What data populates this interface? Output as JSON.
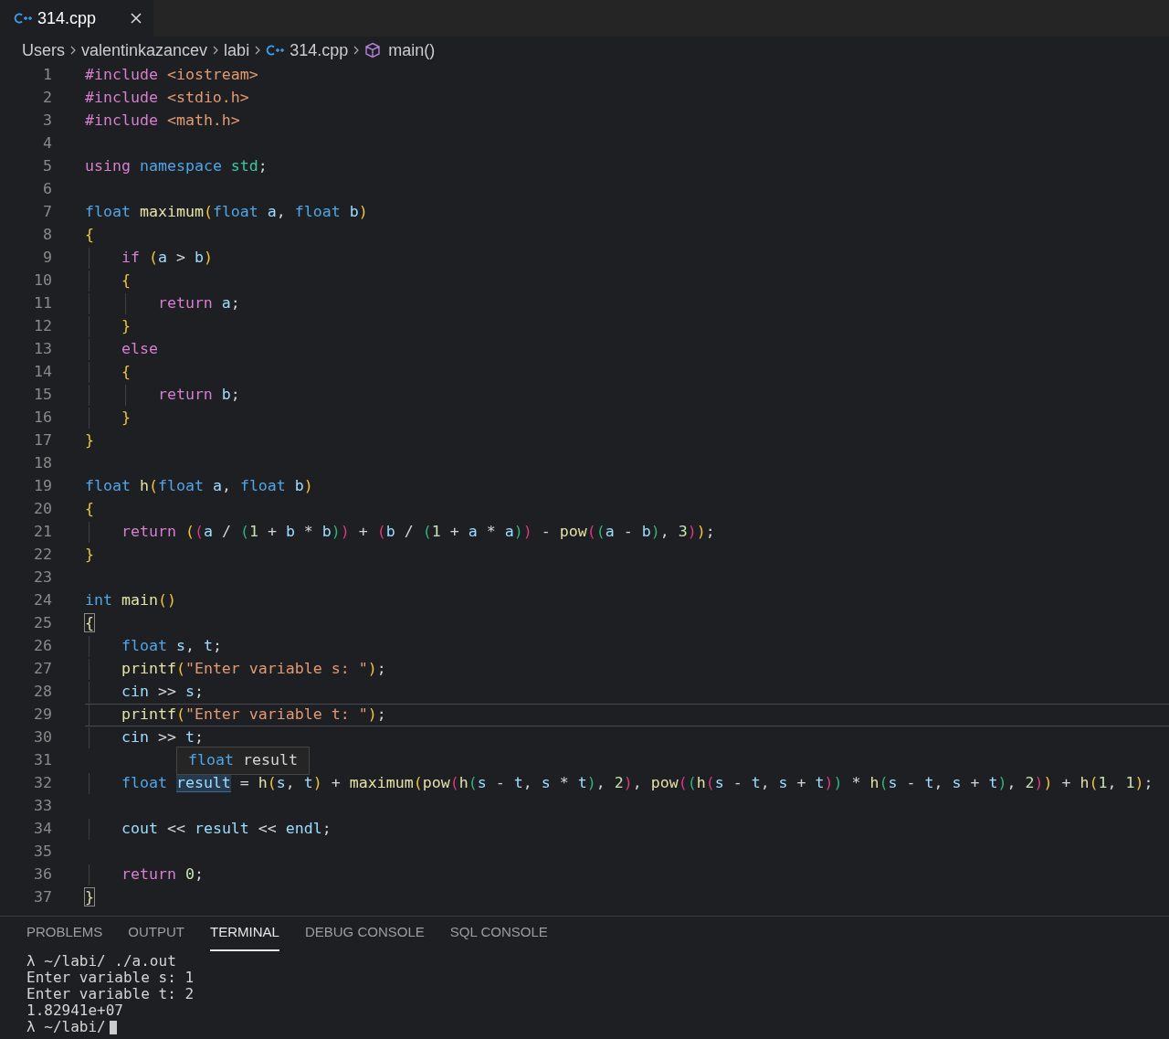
{
  "tabs": [
    {
      "label": "314.cpp",
      "selected": true
    }
  ],
  "breadcrumb": [
    {
      "label": "Users",
      "kind": "folder"
    },
    {
      "label": "valentinkazancev",
      "kind": "folder"
    },
    {
      "label": "labi",
      "kind": "folder"
    },
    {
      "label": "314.cpp",
      "kind": "file"
    },
    {
      "label": "main()",
      "kind": "symbol"
    }
  ],
  "lines": [
    {
      "number": "1",
      "current": false,
      "tokens": [
        {
          "kind": "keyword",
          "text": "#include "
        },
        {
          "kind": "string",
          "text": "<iostream>"
        }
      ]
    },
    {
      "number": "2",
      "current": false,
      "tokens": [
        {
          "kind": "keyword",
          "text": "#include "
        },
        {
          "kind": "string",
          "text": "<stdio.h>"
        }
      ]
    },
    {
      "number": "3",
      "current": false,
      "tokens": [
        {
          "kind": "keyword",
          "text": "#include "
        },
        {
          "kind": "string",
          "text": "<math.h>"
        }
      ]
    },
    {
      "number": "4",
      "current": false
    },
    {
      "number": "5",
      "current": false,
      "tokens": [
        {
          "kind": "keyword",
          "text": "using "
        },
        {
          "kind": "type",
          "text": "namespace "
        },
        {
          "kind": "class",
          "text": "std"
        },
        {
          "kind": "plain",
          "text": ";"
        }
      ]
    },
    {
      "number": "6",
      "current": false
    },
    {
      "number": "7",
      "current": false,
      "tokens": [
        {
          "kind": "type",
          "text": "float "
        },
        {
          "kind": "function",
          "text": "maximum"
        },
        {
          "kind": "bracket1",
          "text": "("
        },
        {
          "kind": "type",
          "text": "float "
        },
        {
          "kind": "variable",
          "text": "a"
        },
        {
          "kind": "plain",
          "text": ", "
        },
        {
          "kind": "type",
          "text": "float "
        },
        {
          "kind": "variable",
          "text": "b"
        },
        {
          "kind": "bracket1",
          "text": ")"
        }
      ]
    },
    {
      "number": "8",
      "current": false,
      "tokens": [
        {
          "kind": "bracket1",
          "text": "{"
        }
      ]
    },
    {
      "number": "9",
      "current": false,
      "tokens": [
        {
          "kind": "keyword",
          "text": "    if "
        },
        {
          "kind": "bracket1",
          "text": "("
        },
        {
          "kind": "variable",
          "text": "a"
        },
        {
          "kind": "plain",
          "text": " > "
        },
        {
          "kind": "variable",
          "text": "b"
        },
        {
          "kind": "bracket1",
          "text": ")"
        }
      ]
    },
    {
      "number": "10",
      "current": false,
      "tokens": [
        {
          "kind": "bracket1",
          "text": "    {"
        }
      ]
    },
    {
      "number": "11",
      "current": false,
      "tokens": [
        {
          "kind": "keyword",
          "text": "        return "
        },
        {
          "kind": "variable",
          "text": "a"
        },
        {
          "kind": "plain",
          "text": ";"
        }
      ]
    },
    {
      "number": "12",
      "current": false,
      "tokens": [
        {
          "kind": "bracket1",
          "text": "    }"
        }
      ]
    },
    {
      "number": "13",
      "current": false,
      "tokens": [
        {
          "kind": "keyword",
          "text": "    else"
        }
      ]
    },
    {
      "number": "14",
      "current": false,
      "tokens": [
        {
          "kind": "bracket1",
          "text": "    {"
        }
      ]
    },
    {
      "number": "15",
      "current": false,
      "tokens": [
        {
          "kind": "keyword",
          "text": "        return "
        },
        {
          "kind": "variable",
          "text": "b"
        },
        {
          "kind": "plain",
          "text": ";"
        }
      ]
    },
    {
      "number": "16",
      "current": false,
      "tokens": [
        {
          "kind": "bracket1",
          "text": "    }"
        }
      ]
    },
    {
      "number": "17",
      "current": false,
      "tokens": [
        {
          "kind": "bracket1",
          "text": "}"
        }
      ]
    },
    {
      "number": "18",
      "current": false
    },
    {
      "number": "19",
      "current": false,
      "tokens": [
        {
          "kind": "type",
          "text": "float "
        },
        {
          "kind": "function",
          "text": "h"
        },
        {
          "kind": "bracket1",
          "text": "("
        },
        {
          "kind": "type",
          "text": "float "
        },
        {
          "kind": "variable",
          "text": "a"
        },
        {
          "kind": "plain",
          "text": ", "
        },
        {
          "kind": "type",
          "text": "float "
        },
        {
          "kind": "variable",
          "text": "b"
        },
        {
          "kind": "bracket1",
          "text": ")"
        }
      ]
    },
    {
      "number": "20",
      "current": false,
      "tokens": [
        {
          "kind": "bracket1",
          "text": "{"
        }
      ]
    },
    {
      "number": "21",
      "current": false,
      "tokens": [
        {
          "kind": "keyword",
          "text": "    return "
        },
        {
          "kind": "bracket1",
          "text": "("
        },
        {
          "kind": "bracket2",
          "text": "("
        },
        {
          "kind": "variable",
          "text": "a"
        },
        {
          "kind": "plain",
          "text": " / "
        },
        {
          "kind": "bracket3",
          "text": "("
        },
        {
          "kind": "number",
          "text": "1"
        },
        {
          "kind": "plain",
          "text": " + "
        },
        {
          "kind": "variable",
          "text": "b"
        },
        {
          "kind": "plain",
          "text": " * "
        },
        {
          "kind": "variable",
          "text": "b"
        },
        {
          "kind": "bracket3",
          "text": ")"
        },
        {
          "kind": "bracket2",
          "text": ")"
        },
        {
          "kind": "plain",
          "text": " + "
        },
        {
          "kind": "bracket2",
          "text": "("
        },
        {
          "kind": "variable",
          "text": "b"
        },
        {
          "kind": "plain",
          "text": " / "
        },
        {
          "kind": "bracket3",
          "text": "("
        },
        {
          "kind": "number",
          "text": "1"
        },
        {
          "kind": "plain",
          "text": " + "
        },
        {
          "kind": "variable",
          "text": "a"
        },
        {
          "kind": "plain",
          "text": " * "
        },
        {
          "kind": "variable",
          "text": "a"
        },
        {
          "kind": "bracket3",
          "text": ")"
        },
        {
          "kind": "bracket2",
          "text": ")"
        },
        {
          "kind": "plain",
          "text": " - "
        },
        {
          "kind": "function",
          "text": "pow"
        },
        {
          "kind": "bracket2",
          "text": "("
        },
        {
          "kind": "bracket3",
          "text": "("
        },
        {
          "kind": "variable",
          "text": "a"
        },
        {
          "kind": "plain",
          "text": " - "
        },
        {
          "kind": "variable",
          "text": "b"
        },
        {
          "kind": "bracket3",
          "text": ")"
        },
        {
          "kind": "plain",
          "text": ", "
        },
        {
          "kind": "number",
          "text": "3"
        },
        {
          "kind": "bracket2",
          "text": ")"
        },
        {
          "kind": "bracket1",
          "text": ")"
        },
        {
          "kind": "plain",
          "text": ";"
        }
      ]
    },
    {
      "number": "22",
      "current": false,
      "tokens": [
        {
          "kind": "bracket1",
          "text": "}"
        }
      ]
    },
    {
      "number": "23",
      "current": false
    },
    {
      "number": "24",
      "current": false,
      "tokens": [
        {
          "kind": "type",
          "text": "int "
        },
        {
          "kind": "function",
          "text": "main"
        },
        {
          "kind": "bracket1",
          "text": "()"
        }
      ]
    },
    {
      "number": "25",
      "current": false,
      "tokens": [
        {
          "kind": "match",
          "text": "{"
        }
      ]
    },
    {
      "number": "26",
      "current": false,
      "tokens": [
        {
          "kind": "type",
          "text": "    float "
        },
        {
          "kind": "variable",
          "text": "s"
        },
        {
          "kind": "plain",
          "text": ", "
        },
        {
          "kind": "variable",
          "text": "t"
        },
        {
          "kind": "plain",
          "text": ";"
        }
      ]
    },
    {
      "number": "27",
      "current": false,
      "tokens": [
        {
          "kind": "function",
          "text": "    printf"
        },
        {
          "kind": "bracket1",
          "text": "("
        },
        {
          "kind": "string",
          "text": "\"Enter variable s: \""
        },
        {
          "kind": "bracket1",
          "text": ")"
        },
        {
          "kind": "plain",
          "text": ";"
        }
      ]
    },
    {
      "number": "28",
      "current": false,
      "tokens": [
        {
          "kind": "variable",
          "text": "    cin"
        },
        {
          "kind": "plain",
          "text": " >> "
        },
        {
          "kind": "variable",
          "text": "s"
        },
        {
          "kind": "plain",
          "text": ";"
        }
      ]
    },
    {
      "number": "29",
      "current": true,
      "tokens": [
        {
          "kind": "function",
          "text": "    printf"
        },
        {
          "kind": "bracket1",
          "text": "("
        },
        {
          "kind": "string",
          "text": "\"Enter variable t: \""
        },
        {
          "kind": "bracket1",
          "text": ")"
        },
        {
          "kind": "plain",
          "text": ";"
        }
      ]
    },
    {
      "number": "30",
      "current": false,
      "tokens": [
        {
          "kind": "variable",
          "text": "    cin"
        },
        {
          "kind": "plain",
          "text": " >> "
        },
        {
          "kind": "variable",
          "text": "t"
        },
        {
          "kind": "plain",
          "text": ";"
        }
      ]
    },
    {
      "number": "31",
      "current": false
    },
    {
      "number": "32",
      "current": false,
      "tokens": [
        {
          "kind": "type",
          "text": "    float "
        },
        {
          "kind": "highlight",
          "text": "result"
        },
        {
          "kind": "plain",
          "text": " = "
        },
        {
          "kind": "function",
          "text": "h"
        },
        {
          "kind": "bracket1",
          "text": "("
        },
        {
          "kind": "variable",
          "text": "s"
        },
        {
          "kind": "plain",
          "text": ", "
        },
        {
          "kind": "variable",
          "text": "t"
        },
        {
          "kind": "bracket1",
          "text": ")"
        },
        {
          "kind": "plain",
          "text": " + "
        },
        {
          "kind": "function",
          "text": "maximum"
        },
        {
          "kind": "bracket1",
          "text": "("
        },
        {
          "kind": "function",
          "text": "pow"
        },
        {
          "kind": "bracket2",
          "text": "("
        },
        {
          "kind": "function",
          "text": "h"
        },
        {
          "kind": "bracket3",
          "text": "("
        },
        {
          "kind": "variable",
          "text": "s"
        },
        {
          "kind": "plain",
          "text": " - "
        },
        {
          "kind": "variable",
          "text": "t"
        },
        {
          "kind": "plain",
          "text": ", "
        },
        {
          "kind": "variable",
          "text": "s"
        },
        {
          "kind": "plain",
          "text": " * "
        },
        {
          "kind": "variable",
          "text": "t"
        },
        {
          "kind": "bracket3",
          "text": ")"
        },
        {
          "kind": "plain",
          "text": ", "
        },
        {
          "kind": "number",
          "text": "2"
        },
        {
          "kind": "bracket2",
          "text": ")"
        },
        {
          "kind": "plain",
          "text": ", "
        },
        {
          "kind": "function",
          "text": "pow"
        },
        {
          "kind": "bracket2",
          "text": "("
        },
        {
          "kind": "bracket3",
          "text": "("
        },
        {
          "kind": "function",
          "text": "h"
        },
        {
          "kind": "bracket2",
          "text": "("
        },
        {
          "kind": "variable",
          "text": "s"
        },
        {
          "kind": "plain",
          "text": " - "
        },
        {
          "kind": "variable",
          "text": "t"
        },
        {
          "kind": "plain",
          "text": ", "
        },
        {
          "kind": "variable",
          "text": "s"
        },
        {
          "kind": "plain",
          "text": " + "
        },
        {
          "kind": "variable",
          "text": "t"
        },
        {
          "kind": "bracket2",
          "text": ")"
        },
        {
          "kind": "bracket3",
          "text": ")"
        },
        {
          "kind": "plain",
          "text": " * "
        },
        {
          "kind": "function",
          "text": "h"
        },
        {
          "kind": "bracket3",
          "text": "("
        },
        {
          "kind": "variable",
          "text": "s"
        },
        {
          "kind": "plain",
          "text": " - "
        },
        {
          "kind": "variable",
          "text": "t"
        },
        {
          "kind": "plain",
          "text": ", "
        },
        {
          "kind": "variable",
          "text": "s"
        },
        {
          "kind": "plain",
          "text": " + "
        },
        {
          "kind": "variable",
          "text": "t"
        },
        {
          "kind": "bracket3",
          "text": ")"
        },
        {
          "kind": "plain",
          "text": ", "
        },
        {
          "kind": "number",
          "text": "2"
        },
        {
          "kind": "bracket2",
          "text": ")"
        },
        {
          "kind": "bracket1",
          "text": ")"
        },
        {
          "kind": "plain",
          "text": " + "
        },
        {
          "kind": "function",
          "text": "h"
        },
        {
          "kind": "bracket1",
          "text": "("
        },
        {
          "kind": "number",
          "text": "1"
        },
        {
          "kind": "plain",
          "text": ", "
        },
        {
          "kind": "number",
          "text": "1"
        },
        {
          "kind": "bracket1",
          "text": ")"
        },
        {
          "kind": "plain",
          "text": ";"
        }
      ]
    },
    {
      "number": "33",
      "current": false
    },
    {
      "number": "34",
      "current": false,
      "tokens": [
        {
          "kind": "variable",
          "text": "    cout"
        },
        {
          "kind": "plain",
          "text": " << "
        },
        {
          "kind": "variable",
          "text": "result"
        },
        {
          "kind": "plain",
          "text": " << "
        },
        {
          "kind": "variable",
          "text": "endl"
        },
        {
          "kind": "plain",
          "text": ";"
        }
      ]
    },
    {
      "number": "35",
      "current": false
    },
    {
      "number": "36",
      "current": false,
      "tokens": [
        {
          "kind": "keyword",
          "text": "    return "
        },
        {
          "kind": "number",
          "text": "0"
        },
        {
          "kind": "plain",
          "text": ";"
        }
      ]
    },
    {
      "number": "37",
      "current": false,
      "tokens": [
        {
          "kind": "match",
          "text": "}"
        }
      ]
    }
  ],
  "hover": {
    "type": "float",
    "name": "result"
  },
  "panel_tabs": [
    {
      "label": "PROBLEMS",
      "selected": false
    },
    {
      "label": "OUTPUT",
      "selected": false
    },
    {
      "label": "TERMINAL",
      "selected": true
    },
    {
      "label": "DEBUG CONSOLE",
      "selected": false
    },
    {
      "label": "SQL CONSOLE",
      "selected": false
    }
  ],
  "terminal": [
    "λ ~/labi/ ./a.out",
    "Enter variable s: 1",
    "Enter variable t: 2",
    "1.82941e+07",
    "λ ~/labi/"
  ]
}
